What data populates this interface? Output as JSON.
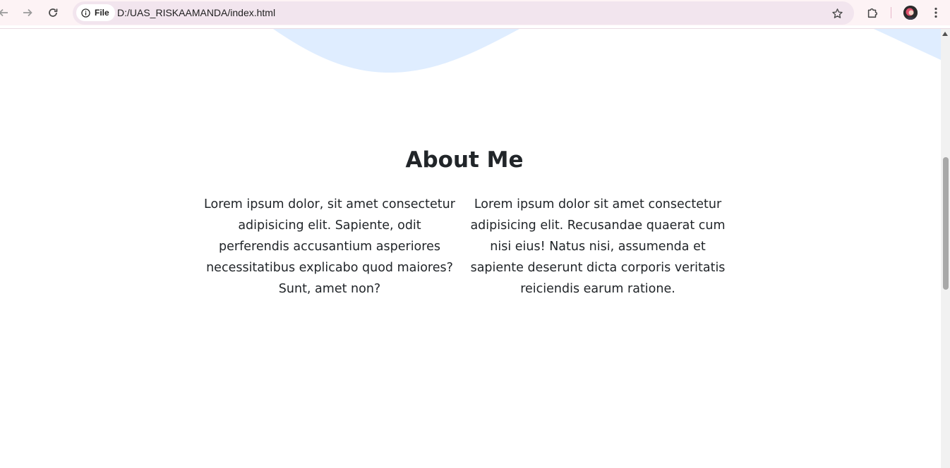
{
  "browser": {
    "site_chip_label": "File",
    "url": "D:/UAS_RISKAAMANDA/index.html",
    "icons": {
      "back": "arrow-left-icon",
      "forward": "arrow-right-icon",
      "reload": "reload-icon",
      "site_info": "info-icon",
      "bookmark": "star-icon",
      "extensions": "puzzle-icon",
      "profile": "avatar",
      "menu": "kebab-menu-icon"
    }
  },
  "page": {
    "about": {
      "title": "About Me",
      "paragraphs": [
        "Lorem ipsum dolor, sit amet consectetur adipisicing elit. Sapiente, odit perferendis accusantium asperiores necessitatibus explicabo quod maiores? Sunt, amet non?",
        "Lorem ipsum dolor sit amet consectetur adipisicing elit. Recusandae quaerat cum nisi eius! Natus nisi, assumenda et sapiente deserunt dicta corporis veritatis reiciendis earum ratione."
      ]
    },
    "colors": {
      "wave": "#dfedff",
      "text": "#212529",
      "toolbar": "#fdf3f5",
      "omnibox": "#f2e5ee"
    }
  }
}
